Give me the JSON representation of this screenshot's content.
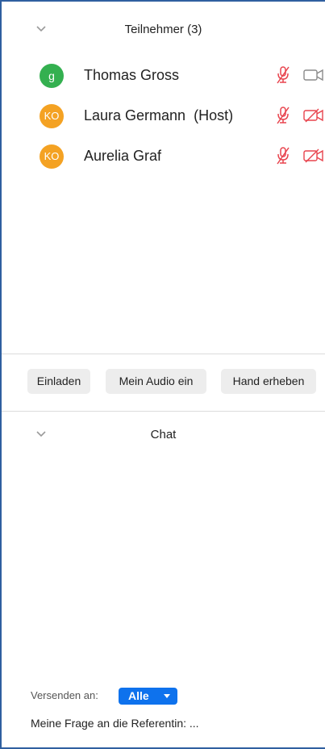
{
  "participants_panel": {
    "title": "Teilnehmer (3)",
    "participants": [
      {
        "initials": "g",
        "name": "Thomas Gross",
        "avatar_color": "#34b050",
        "mic_muted": true,
        "video_on": true
      },
      {
        "initials": "KO",
        "name": "Laura Germann  (Host)",
        "avatar_color": "#f4a223",
        "mic_muted": true,
        "video_on": false
      },
      {
        "initials": "KO",
        "name": "Aurelia Graf",
        "avatar_color": "#f4a223",
        "mic_muted": true,
        "video_on": false
      }
    ]
  },
  "actions": {
    "invite_label": "Einladen",
    "audio_label": "Mein Audio ein",
    "raise_hand_label": "Hand erheben"
  },
  "chat_panel": {
    "title": "Chat",
    "send_to_label": "Versenden an:",
    "recipient": "Alle",
    "message_draft": "Meine Frage an die Referentin: ..."
  },
  "colors": {
    "muted_icon": "#e8434d",
    "video_on_icon": "#8a8a8a",
    "accent": "#0e72ed",
    "window_border": "#2f5fa0"
  },
  "icons": {
    "collapse": "chevron-down-icon",
    "mic_muted": "mic-muted-icon",
    "video_on": "video-camera-icon",
    "video_off": "video-camera-off-icon"
  }
}
